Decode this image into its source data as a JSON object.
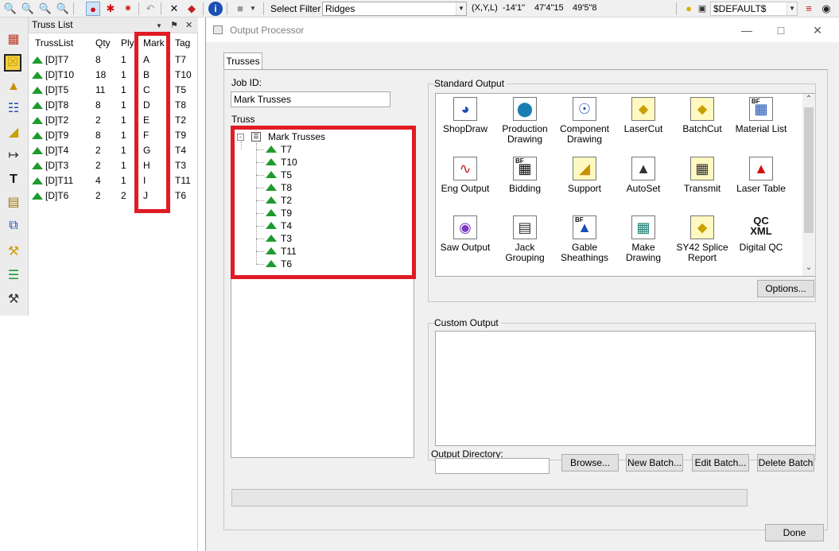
{
  "toolbar": {
    "select_filter_label": "Select Filter",
    "filter_value": "Ridges",
    "coord_label": "(X,Y,L)",
    "coord_x": "-14'1\"",
    "coord_y": "47'4\"15",
    "coord_l": "49'5\"8",
    "layer_value": "$DEFAULT$",
    "icons": [
      "zoom-in-icon",
      "zoom-window-icon",
      "zoom-out-icon",
      "zoom-extents-icon",
      "select-node-icon",
      "snap-star-icon",
      "snap-point-icon",
      "undo-icon",
      "delete-icon",
      "properties-icon",
      "info-icon",
      "layer-icon",
      "lightbulb-icon",
      "lock-icon",
      "layers-stack-icon",
      "eye-icon"
    ]
  },
  "leftbar": {
    "icons": [
      "wall-icon",
      "roof-plane-icon",
      "truss-icon",
      "bearing-icon",
      "ramp-icon",
      "dimension-icon",
      "t-label-icon",
      "stack-icon",
      "copy-icon",
      "hammer-icon",
      "list-icon",
      "tools-icon"
    ]
  },
  "truss_panel": {
    "title": "Truss List",
    "columns": [
      "TrussList",
      "Qty",
      "Ply",
      "Mark",
      "Tag"
    ],
    "rows": [
      {
        "name": "[D]T7",
        "qty": "8",
        "ply": "1",
        "mark": "A",
        "tag": "T7"
      },
      {
        "name": "[D]T10",
        "qty": "18",
        "ply": "1",
        "mark": "B",
        "tag": "T10"
      },
      {
        "name": "[D]T5",
        "qty": "11",
        "ply": "1",
        "mark": "C",
        "tag": "T5"
      },
      {
        "name": "[D]T8",
        "qty": "8",
        "ply": "1",
        "mark": "D",
        "tag": "T8"
      },
      {
        "name": "[D]T2",
        "qty": "2",
        "ply": "1",
        "mark": "E",
        "tag": "T2"
      },
      {
        "name": "[D]T9",
        "qty": "8",
        "ply": "1",
        "mark": "F",
        "tag": "T9"
      },
      {
        "name": "[D]T4",
        "qty": "2",
        "ply": "1",
        "mark": "G",
        "tag": "T4"
      },
      {
        "name": "[D]T3",
        "qty": "2",
        "ply": "1",
        "mark": "H",
        "tag": "T3"
      },
      {
        "name": "[D]T11",
        "qty": "4",
        "ply": "1",
        "mark": "I",
        "tag": "T11"
      },
      {
        "name": "[D]T6",
        "qty": "2",
        "ply": "2",
        "mark": "J",
        "tag": "T6"
      }
    ],
    "highlight_color": "#e01b24"
  },
  "dialog": {
    "title": "Output Processor",
    "tab": "Trusses",
    "job_id_label": "Job ID:",
    "job_id_value": "Mark Trusses",
    "truss_label": "Truss",
    "tree_root": "Mark Trusses",
    "tree_items": [
      "T7",
      "T10",
      "T5",
      "T8",
      "T2",
      "T9",
      "T4",
      "T3",
      "T11",
      "T6"
    ],
    "standard_output_label": "Standard Output",
    "outputs": [
      {
        "label": "ShopDraw",
        "icon": "shopdraw-icon"
      },
      {
        "label": "Production Drawing",
        "icon": "production-drawing-icon"
      },
      {
        "label": "Component Drawing",
        "icon": "component-drawing-icon"
      },
      {
        "label": "LaserCut",
        "icon": "lasercut-icon"
      },
      {
        "label": "BatchCut",
        "icon": "batchcut-icon"
      },
      {
        "label": "Material List",
        "icon": "material-list-icon"
      },
      {
        "label": "Eng Output",
        "icon": "eng-output-icon"
      },
      {
        "label": "Bidding",
        "icon": "bidding-icon"
      },
      {
        "label": "Support",
        "icon": "support-icon"
      },
      {
        "label": "AutoSet",
        "icon": "autoset-icon"
      },
      {
        "label": "Transmit",
        "icon": "transmit-icon"
      },
      {
        "label": "Laser Table",
        "icon": "laser-table-icon"
      },
      {
        "label": "Saw Output",
        "icon": "saw-output-icon"
      },
      {
        "label": "Jack Grouping",
        "icon": "jack-grouping-icon"
      },
      {
        "label": "Gable Sheathings",
        "icon": "gable-sheathings-icon"
      },
      {
        "label": "Make Drawing",
        "icon": "make-drawing-icon"
      },
      {
        "label": "SY42 Splice Report",
        "icon": "splice-report-icon"
      },
      {
        "label": "Digital QC",
        "icon": "digital-qc-icon"
      }
    ],
    "options_button": "Options...",
    "custom_output_label": "Custom Output",
    "output_directory_label": "Output Directory:",
    "output_directory_value": "",
    "browse_button": "Browse...",
    "new_batch_button": "New Batch...",
    "edit_batch_button": "Edit Batch...",
    "delete_batch_button": "Delete Batch",
    "done_button": "Done",
    "bf_badge": "BF",
    "qc_badge_top": "QC",
    "qc_badge_bottom": "XML"
  }
}
